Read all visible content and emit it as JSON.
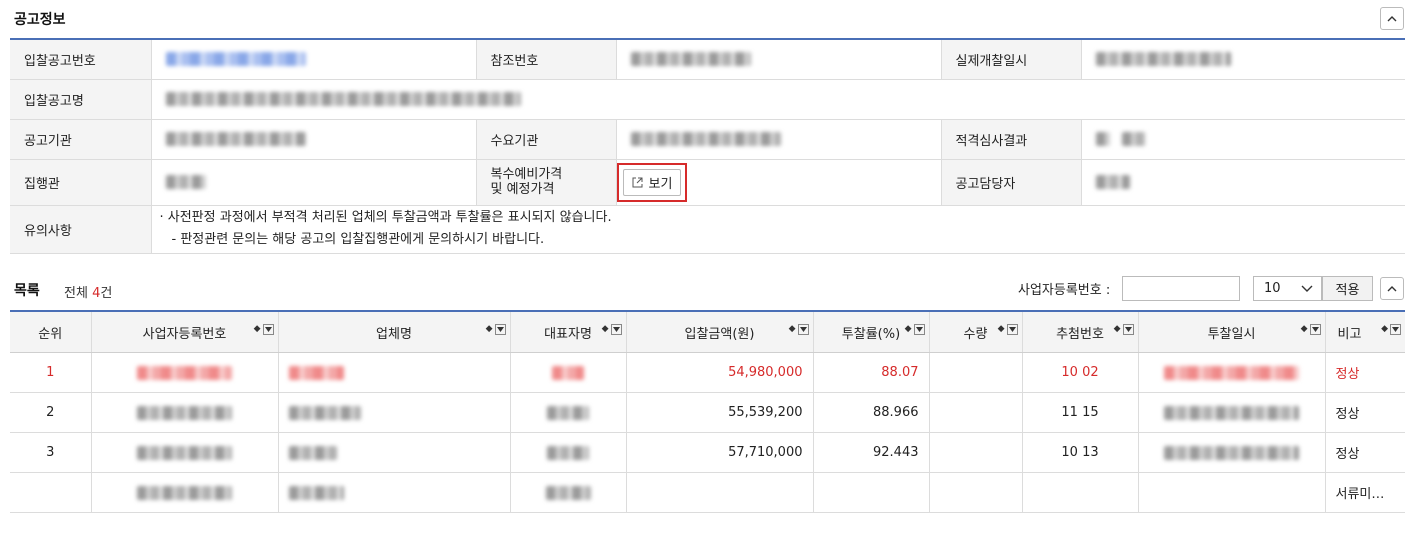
{
  "notice_section": {
    "title": "공고정보",
    "labels": {
      "bid_no": "입찰공고번호",
      "ref_no": "참조번호",
      "actual_open": "실제개찰일시",
      "bid_name": "입찰공고명",
      "agency": "공고기관",
      "demand_agency": "수요기관",
      "qualification": "적격심사결과",
      "executor": "집행관",
      "multi_price_1": "복수예비가격",
      "multi_price_2": "및 예정가격",
      "manager": "공고담당자",
      "notes": "유의사항"
    },
    "view_button": "보기",
    "notes_lines": [
      "· 사전판정 과정에서 부적격 처리된 업체의 투찰금액과 투찰률은 표시되지 않습니다.",
      "- 판정관련 문의는 해당 공고의 입찰집행관에게 문의하시기 바랍니다."
    ]
  },
  "list_section": {
    "title": "목록",
    "total_prefix": "전체 ",
    "total_count": "4",
    "total_suffix": "건",
    "reg_no_label": "사업자등록번호 :",
    "reg_no_value": "",
    "page_size": "10",
    "apply_button": "적용",
    "columns": [
      "순위",
      "사업자등록번호",
      "업체명",
      "대표자명",
      "입찰금액(원)",
      "투찰률(%)",
      "수량",
      "추첨번호",
      "투찰일시",
      "비고"
    ],
    "rows": [
      {
        "rank": "1",
        "amount": "54,980,000",
        "rate": "88.07",
        "qty": "",
        "draw": "10 02",
        "note": "정상"
      },
      {
        "rank": "2",
        "amount": "55,539,200",
        "rate": "88.966",
        "qty": "",
        "draw": "11 15",
        "note": "정상"
      },
      {
        "rank": "3",
        "amount": "57,710,000",
        "rate": "92.443",
        "qty": "",
        "draw": "10 13",
        "note": "정상"
      },
      {
        "rank": "",
        "amount": "",
        "rate": "",
        "qty": "",
        "draw": "",
        "note": "서류미…"
      }
    ]
  },
  "colors": {
    "accent_blue": "#4a6fb6",
    "highlight_red": "#d62b2b",
    "label_bg": "#f4f4f4"
  },
  "icons": [
    "chevron-up-icon",
    "external-link-icon",
    "chevron-down-icon",
    "sort-icon",
    "dropdown-icon"
  ]
}
